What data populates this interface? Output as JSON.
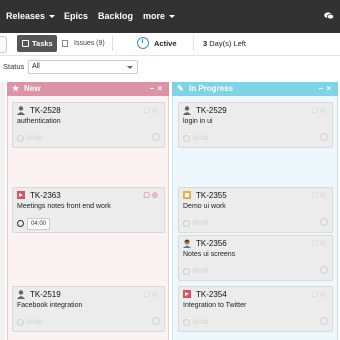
{
  "nav": {
    "releases": "Releases",
    "epics": "Epics",
    "backlog": "Backlog",
    "more": "more"
  },
  "toolbar": {
    "tasks": "Tasks",
    "issues": "Issues (9)",
    "status": "Active",
    "days_left_num": "3",
    "days_left_text": "Day(s) Left"
  },
  "filter": {
    "label": "Status",
    "value": "All"
  },
  "columns": {
    "new": {
      "title": "New",
      "color": "#dc93a8",
      "cards": [
        {
          "id": "TK-2528",
          "title": "authentication",
          "time": "00:00"
        },
        {
          "id": "TK-2363",
          "title": "Meetings notes front end work",
          "time": "04:00"
        },
        {
          "id": "TK-2519",
          "title": "Facebook integration",
          "time": "00:00"
        }
      ]
    },
    "in_progress": {
      "title": "In Progress",
      "color": "#7fd3e6",
      "cards": [
        {
          "id": "TK-2529",
          "title": "login in ui",
          "time": "00:00"
        },
        {
          "id": "TK-2355",
          "title": "Demo ui work",
          "time": "00:00"
        },
        {
          "id": "TK-2356",
          "title": "Notes ui screens",
          "time": "00:00"
        },
        {
          "id": "TK-2354",
          "title": "Integration to Twitter",
          "time": "00:00"
        }
      ]
    }
  }
}
